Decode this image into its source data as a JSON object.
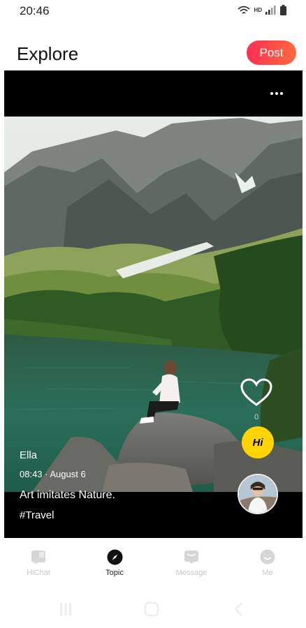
{
  "status_bar": {
    "time": "20:46",
    "network_label": "HD"
  },
  "header": {
    "title": "Explore",
    "post_label": "Post"
  },
  "post": {
    "author": "Ella",
    "time": "08:43 · August 6",
    "caption": "Art imitates Nature.",
    "tag": "#Travel",
    "like_count": "0",
    "hi_label": "Hi"
  },
  "tabs": [
    {
      "label": "HiChat",
      "icon": "chat-icon",
      "active": false
    },
    {
      "label": "Topic",
      "icon": "compass-icon",
      "active": true
    },
    {
      "label": "Message",
      "icon": "message-icon",
      "active": false
    },
    {
      "label": "Me",
      "icon": "smile-icon",
      "active": false
    }
  ],
  "colors": {
    "accent_start": "#ff2e55",
    "accent_end": "#ff6a3d",
    "hi_yellow": "#ffd400"
  }
}
